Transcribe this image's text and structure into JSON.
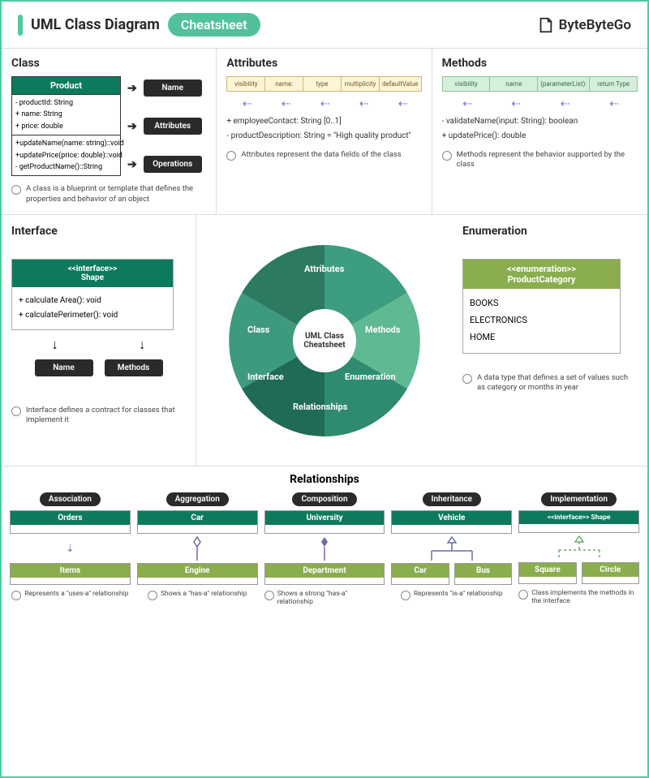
{
  "header": {
    "title": "UML Class Diagram",
    "pill": "Cheatsheet",
    "brand": "ByteByteGo"
  },
  "classPanel": {
    "title": "Class",
    "box": {
      "name": "Product",
      "attrs": [
        "- productId: String",
        "+ name: String",
        "+ price: double"
      ],
      "ops": [
        "+updateName(name: string)::void",
        "+updatePrice(price: double)::void",
        "- getProductName()::String"
      ]
    },
    "labels": {
      "name": "Name",
      "attrs": "Attributes",
      "ops": "Operations"
    },
    "note": "A class is a blueprint or template that defines the properties and behavior of an object"
  },
  "attrPanel": {
    "title": "Attributes",
    "cols": [
      "visibility",
      "name:",
      "type",
      "multiplicity",
      "defaultValue"
    ],
    "ex1": "+ employeeContact: String [0..1]",
    "ex2": "- productDescription: String = \"High quality product\"",
    "note": "Attributes represent the data fields of the class"
  },
  "methPanel": {
    "title": "Methods",
    "cols": [
      "visibility",
      "name",
      "(parameterList):",
      "return Type"
    ],
    "ex1": "- validateName(input: String): boolean",
    "ex2": "+ updatePrice(): double",
    "note": "Methods represent the behavior supported by the class"
  },
  "interfacePanel": {
    "title": "Interface",
    "stereo": "<<interface>>",
    "name": "Shape",
    "methods": [
      "+ calculate Area(): void",
      "+ calculatePerimeter(): void"
    ],
    "labels": {
      "name": "Name",
      "methods": "Methods"
    },
    "note": "Interface defines a contract for classes that implement it"
  },
  "wheel": {
    "center": "UML Class Cheatsheet",
    "slices": [
      "Attributes",
      "Methods",
      "Enumeration",
      "Relationships",
      "Interface",
      "Class"
    ]
  },
  "enumPanel": {
    "title": "Enumeration",
    "stereo": "<<enumeration>>",
    "name": "ProductCategory",
    "values": [
      "BOOKS",
      "ELECTRONICS",
      "HOME"
    ],
    "note": "A data type that defines a set of values such as category or months in year"
  },
  "rel": {
    "title": "Relationships",
    "cols": [
      {
        "tag": "Association",
        "top": "Orders",
        "bot": "Items",
        "note": "Represents a \"uses-a\" relationship"
      },
      {
        "tag": "Aggregation",
        "top": "Car",
        "bot": "Engine",
        "note": "Shows a \"has-a\" relationship"
      },
      {
        "tag": "Composition",
        "top": "University",
        "bot": "Department",
        "note": "Shows a strong \"has-a\" relationship"
      },
      {
        "tag": "Inheritance",
        "top": "Vehicle",
        "bots": [
          "Car",
          "Bus"
        ],
        "note": "Represents \"is-a\" relationship"
      },
      {
        "tag": "Implementation",
        "top": "<<interface>> Shape",
        "bots": [
          "Square",
          "Circle"
        ],
        "note": "Class implements the methods in the interface"
      }
    ]
  }
}
